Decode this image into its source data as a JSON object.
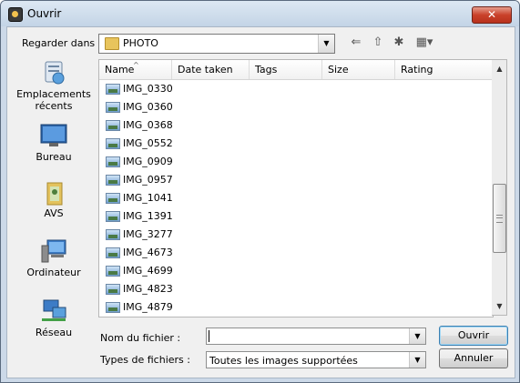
{
  "window": {
    "title": "Ouvrir",
    "close_label": "✕"
  },
  "look_in": {
    "label": "Regarder dans :",
    "value": "PHOTO",
    "dropdown_glyph": "▼"
  },
  "toolbar": {
    "back_glyph": "⇐",
    "up_glyph": "⇧",
    "new_folder_glyph": "✱",
    "views_glyph": "▦▾"
  },
  "places": [
    {
      "label": "Emplacements récents",
      "icon": "recent-places-icon"
    },
    {
      "label": "Bureau",
      "icon": "desktop-icon"
    },
    {
      "label": "AVS",
      "icon": "user-folder-icon"
    },
    {
      "label": "Ordinateur",
      "icon": "computer-icon"
    },
    {
      "label": "Réseau",
      "icon": "network-icon"
    }
  ],
  "columns": [
    "Name",
    "Date taken",
    "Tags",
    "Size",
    "Rating"
  ],
  "sort_indicator": "^",
  "files": [
    "IMG_0330",
    "IMG_0360",
    "IMG_0368",
    "IMG_0552",
    "IMG_0909",
    "IMG_0957",
    "IMG_1041",
    "IMG_1391",
    "IMG_3277",
    "IMG_4673",
    "IMG_4699",
    "IMG_4823",
    "IMG_4879"
  ],
  "scrollbar": {
    "up_glyph": "▲",
    "down_glyph": "▼"
  },
  "filename": {
    "label": "Nom du fichier :",
    "value": ""
  },
  "filetype": {
    "label": "Types de fichiers :",
    "value": "Toutes les images supportées"
  },
  "buttons": {
    "open": "Ouvrir",
    "cancel": "Annuler"
  },
  "colors": {
    "accent": "#3c7fb1",
    "close_button": "#c9412a",
    "title_bar": "#c3d4e6"
  }
}
